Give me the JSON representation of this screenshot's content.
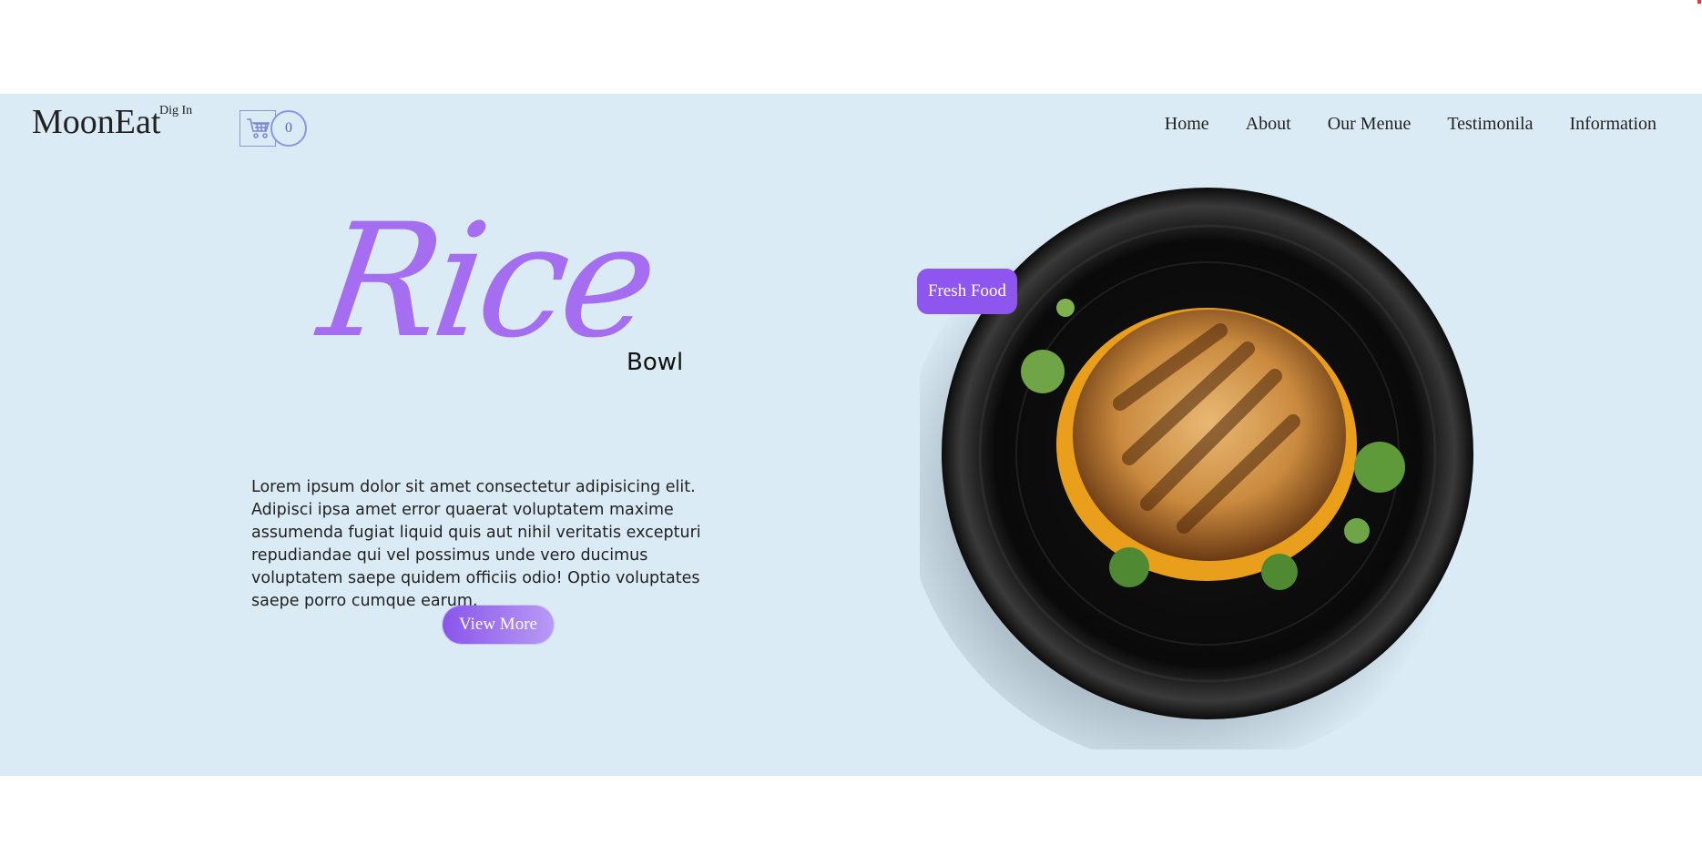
{
  "brand": {
    "name": "MoonEat",
    "tagline": "Dig In"
  },
  "cart": {
    "count": "0",
    "icon": "cart-icon"
  },
  "nav": {
    "items": [
      {
        "label": "Home"
      },
      {
        "label": "About"
      },
      {
        "label": "Our Menue"
      },
      {
        "label": "Testimonila"
      },
      {
        "label": "Information"
      }
    ]
  },
  "hero": {
    "title": "Rice",
    "subtitle": "Bowl",
    "description": "Lorem ipsum dolor sit amet consectetur adipisicing elit. Adipisci ipsa amet error quaerat voluptatem maxime assumenda fugiat liquid quis aut nihil veritatis excepturi repudiandae qui vel possimus unde vero ducimus voluptatem saepe quidem officiis odio! Optio voluptates saepe porro cumque earum.",
    "cta_label": "View More",
    "badge": "Fresh Food",
    "image": "grilled-sandwich-plate"
  },
  "colors": {
    "hero_bg": "#dbebf6",
    "accent": "#8f55ef",
    "cart_outline": "#8d95e0"
  }
}
